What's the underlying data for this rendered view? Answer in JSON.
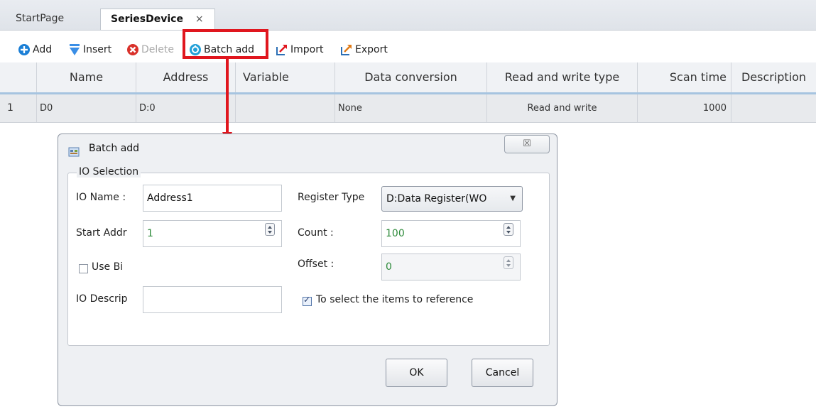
{
  "tabs": [
    {
      "label": "StartPage"
    },
    {
      "label": "SeriesDevice",
      "close": "×"
    }
  ],
  "toolbar": {
    "add": "Add",
    "insert": "Insert",
    "delete": "Delete",
    "batch_add": "Batch add",
    "import": "Import",
    "export": "Export"
  },
  "grid": {
    "columns": [
      "Name",
      "Address",
      "Variable",
      "Data conversion",
      "Read and write type",
      "Scan time",
      "Description"
    ],
    "rows": [
      {
        "index": "1",
        "name": "D0",
        "address": "D:0",
        "variable": "",
        "data_conversion": "None",
        "rw_type": "Read and write",
        "scan_time": "1000",
        "description": ""
      }
    ]
  },
  "dialog": {
    "title": "Batch add",
    "close_glyph": "☒",
    "group_title": "IO Selection",
    "io_name_label": "IO Name :",
    "io_name_value": "Address1",
    "register_type_label": "Register Type",
    "register_type_value": "D:Data Register(WO",
    "start_addr_label": "Start Addr",
    "start_addr_value": "1",
    "count_label": "Count :",
    "count_value": "100",
    "use_bit_label": "Use Bi",
    "offset_label": "Offset :",
    "offset_value": "0",
    "io_desc_label": "IO Descrip",
    "io_desc_value": "",
    "select_items_label": "To select the items to reference",
    "ok": "OK",
    "cancel": "Cancel"
  },
  "colors": {
    "highlight": "#e0161e",
    "accent_value": "#2d8a3a"
  }
}
